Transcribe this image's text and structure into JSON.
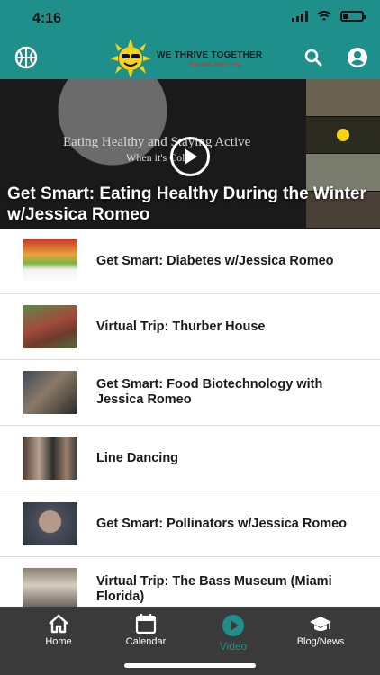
{
  "status": {
    "time": "4:16"
  },
  "header": {
    "logo_title": "WE THRIVE TOGETHER",
    "logo_subtitle": "Stay well, play strong",
    "brand_color": "#1e8f8a"
  },
  "hero": {
    "title": "Get Smart: Eating Healthy During the Winter w/Jessica Romeo",
    "slide_title": "Eating Healthy and Staying Active",
    "slide_sub": "When it's Cold"
  },
  "videos": [
    {
      "title": "Get Smart: Diabetes w/Jessica Romeo"
    },
    {
      "title": "Virtual Trip: Thurber House"
    },
    {
      "title": "Get Smart: Food Biotechnology with Jessica Romeo"
    },
    {
      "title": "Line Dancing"
    },
    {
      "title": "Get Smart: Pollinators w/Jessica Romeo"
    },
    {
      "title": "Virtual Trip: The Bass Museum (Miami Florida)"
    }
  ],
  "tabs": [
    {
      "label": "Home",
      "icon": "home-icon"
    },
    {
      "label": "Calendar",
      "icon": "calendar-icon"
    },
    {
      "label": "Video",
      "icon": "play-circle-icon",
      "active": true
    },
    {
      "label": "Blog/News",
      "icon": "graduation-cap-icon"
    }
  ]
}
